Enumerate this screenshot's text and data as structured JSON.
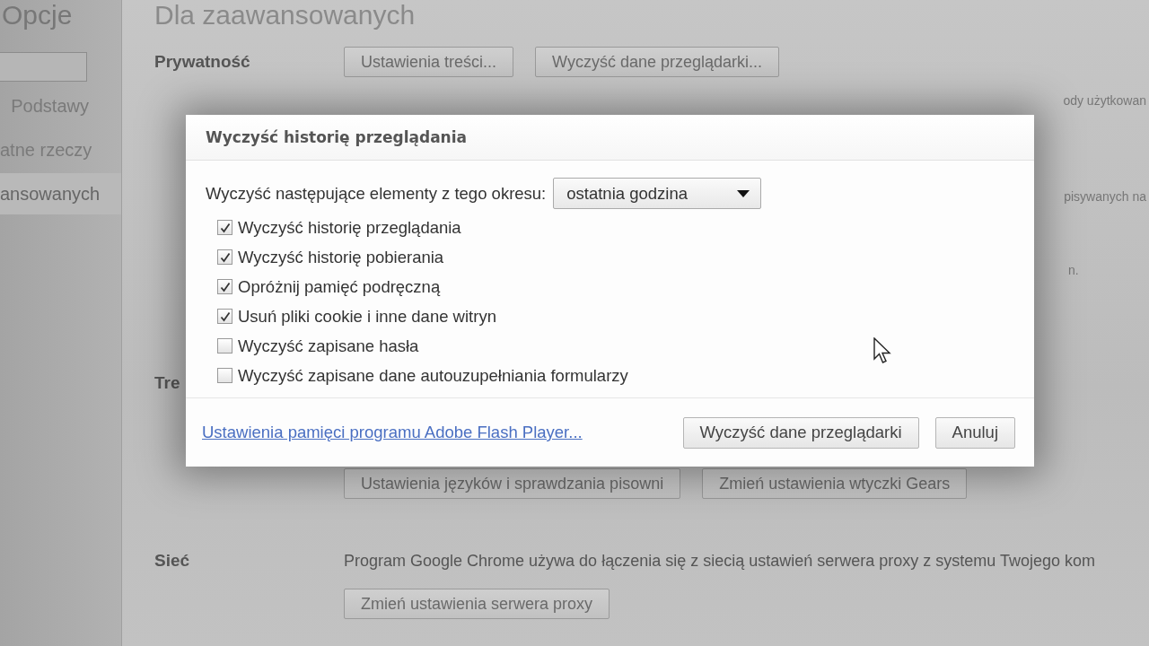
{
  "sidebar": {
    "title": "Opcje",
    "items": [
      {
        "label": "Podstawy",
        "selected": false
      },
      {
        "label": "atne rzeczy",
        "selected": false
      },
      {
        "label": "ansowanych",
        "selected": true
      }
    ]
  },
  "page": {
    "title": "Dla zaawansowanych",
    "privacy": {
      "label": "Prywatność",
      "buttons": [
        "Ustawienia treści...",
        "Wyczyść dane przeglądarki..."
      ],
      "notes": [
        "ody użytkowan",
        "pisywanych na",
        "n."
      ]
    },
    "content_section": {
      "label": "Tre",
      "buttons": [
        "Ustawienia języków i sprawdzania pisowni",
        "Zmień ustawienia wtyczki Gears"
      ]
    },
    "network": {
      "label": "Sieć",
      "text": "Program Google Chrome używa do łączenia się z siecią ustawień serwera proxy z systemu Twojego kom",
      "button": "Zmień ustawienia serwera proxy"
    }
  },
  "dialog": {
    "title": "Wyczyść historię przeglądania",
    "period_label": "Wyczyść następujące elementy z tego okresu:",
    "period": {
      "value": "ostatnia godzina"
    },
    "options": [
      {
        "label": "Wyczyść historię przeglądania",
        "checked": true
      },
      {
        "label": "Wyczyść historię pobierania",
        "checked": true
      },
      {
        "label": "Opróżnij pamięć podręczną",
        "checked": true
      },
      {
        "label": "Usuń pliki cookie i inne dane witryn",
        "checked": true
      },
      {
        "label": "Wyczyść zapisane hasła",
        "checked": false
      },
      {
        "label": "Wyczyść zapisane dane autouzupełniania formularzy",
        "checked": false
      }
    ],
    "link": "Ustawienia pamięci programu Adobe Flash Player...",
    "buttons": [
      "Wyczyść dane przeglądarki",
      "Anuluj"
    ]
  }
}
